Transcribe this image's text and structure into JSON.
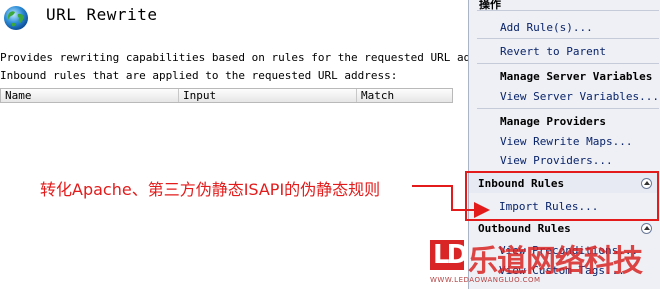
{
  "header": {
    "title": "URL Rewrite",
    "icon": "globe-icon"
  },
  "main": {
    "description": "Provides rewriting capabilities based on rules for the requested URL address",
    "inbound_label": "Inbound rules that are applied to the requested URL address:",
    "columns": [
      "Name",
      "Input",
      "Match"
    ]
  },
  "annotation": {
    "text": "转化Apache、第三方伪静态ISAPI的伪静态规则",
    "color": "#e31b1b"
  },
  "actions": {
    "title": "操作",
    "add_rules": "Add Rule(s)...",
    "revert_to_parent": "Revert to Parent",
    "server_vars_header": "Manage Server Variables",
    "view_server_vars": "View Server Variables...",
    "providers_header": "Manage Providers",
    "view_rewrite_maps": "View Rewrite Maps...",
    "view_providers": "View Providers...",
    "inbound_header": "Inbound Rules",
    "import_rules": "Import Rules...",
    "outbound_header": "Outbound Rules",
    "view_preconditions": "View Preconditions...",
    "view_custom_tags": "View Custom Tags..."
  },
  "watermark": {
    "mark": "LD",
    "name": "乐道网络科技",
    "sub": "WWW.LEDAOWANGLUO.COM"
  }
}
